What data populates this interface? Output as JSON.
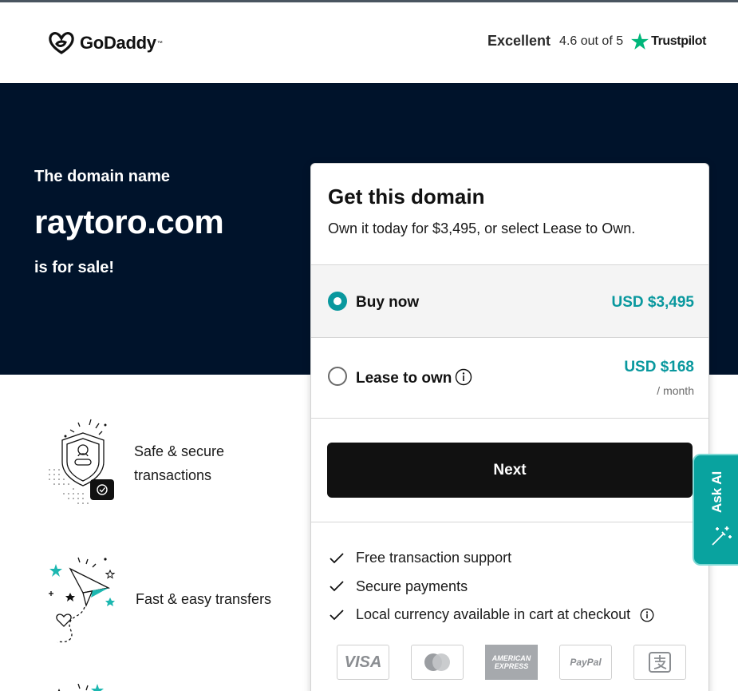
{
  "header": {
    "logo_text": "GoDaddy",
    "trustpilot": {
      "rating_word": "Excellent",
      "score_text": "4.6 out of 5",
      "brand": "Trustpilot"
    }
  },
  "hero": {
    "pre_text": "The domain name",
    "domain": "raytoro.com",
    "post_text": "is for sale!"
  },
  "features": [
    {
      "label_line1": "Safe & secure",
      "label_line2": "transactions",
      "icon": "shield-icon"
    },
    {
      "label_line1": "Fast & easy transfers",
      "icon": "paper-plane-icon"
    }
  ],
  "card": {
    "title": "Get this domain",
    "subtitle": "Own it today for $3,495, or select Lease to Own.",
    "options": [
      {
        "label": "Buy now",
        "price": "USD $3,495",
        "selected": true
      },
      {
        "label": "Lease to own",
        "price": "USD $168",
        "per": "/ month",
        "selected": false
      }
    ],
    "next_label": "Next",
    "benefits": [
      "Free transaction support",
      "Secure payments",
      "Local currency available in cart at checkout"
    ],
    "payment_methods": [
      "visa-icon",
      "mastercard-icon",
      "amex-icon",
      "paypal-icon",
      "alipay-icon"
    ],
    "payment_text": {
      "visa": "VISA",
      "amex_line1": "AMERICAN",
      "amex_line2": "EXPRESS",
      "paypal": "PayPal"
    }
  },
  "ask_ai": {
    "label": "Ask AI"
  },
  "colors": {
    "accent": "#09989e",
    "hero_bg": "#00132b",
    "button_bg": "#111111",
    "trustpilot_green": "#00b67a"
  }
}
